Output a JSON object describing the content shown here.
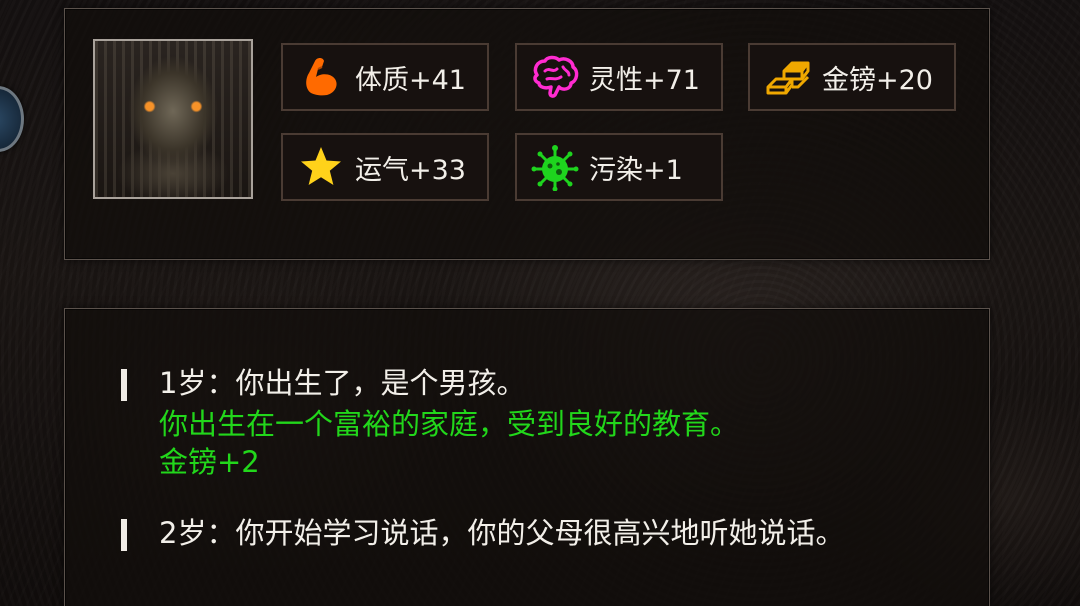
{
  "stats": [
    {
      "label": "体质+41",
      "icon": "flexed-arm-icon",
      "color": "#ff6a00"
    },
    {
      "label": "灵性+71",
      "icon": "brain-icon",
      "color": "#ff2bd0"
    },
    {
      "label": "金镑+20",
      "icon": "gold-bars-icon",
      "color": "#f0a800"
    },
    {
      "label": "运气+33",
      "icon": "star-icon",
      "color": "#ffd21a"
    },
    {
      "label": "污染+1",
      "icon": "virus-icon",
      "color": "#1ed41e"
    }
  ],
  "log": [
    {
      "text": "1岁：你出生了，是个男孩。",
      "events": [
        "你出生在一个富裕的家庭，受到良好的教育。",
        "金镑+2"
      ]
    },
    {
      "text": "2岁：你开始学习说话，你的父母很高兴地听她说话。",
      "events": []
    }
  ]
}
